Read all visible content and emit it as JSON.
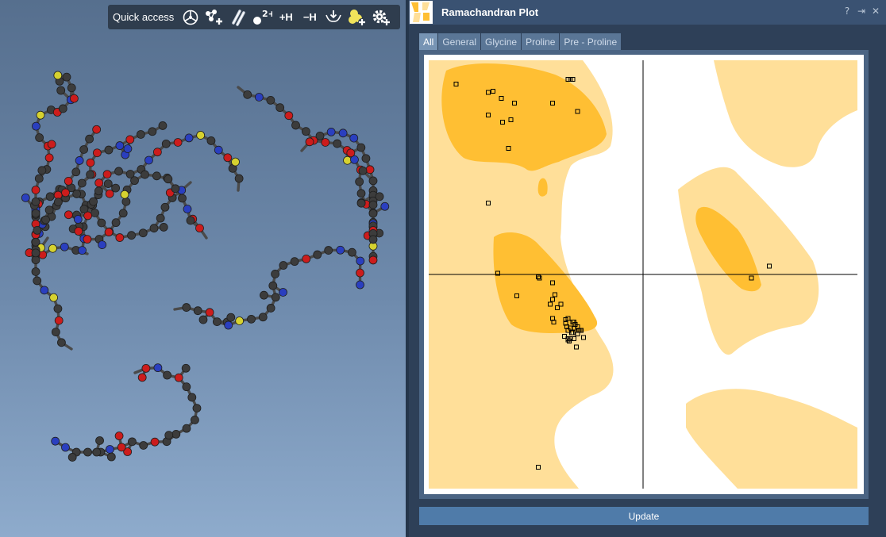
{
  "quick_access": {
    "label": "Quick access",
    "buttons": [
      {
        "name": "wheel-icon",
        "text": ""
      },
      {
        "name": "add-fragment-icon",
        "text": ""
      },
      {
        "name": "bond-tool-icon",
        "text": ""
      },
      {
        "name": "charge-icon",
        "text": ""
      },
      {
        "name": "add-hydrogen-button",
        "text": "+H"
      },
      {
        "name": "remove-hydrogen-button",
        "text": "−H"
      },
      {
        "name": "minimize-icon",
        "text": ""
      },
      {
        "name": "add-ligand-icon",
        "text": ""
      },
      {
        "name": "settings-icon",
        "text": ""
      }
    ]
  },
  "panel": {
    "title": "Ramachandran Plot",
    "controls": [
      "?",
      "⇥",
      "✕"
    ],
    "tabs": [
      "All",
      "General",
      "Glycine",
      "Proline",
      "Pre - Proline"
    ],
    "active_tab": 0,
    "update_label": "Update"
  },
  "colors": {
    "allowed_region": "#ffdf99",
    "favored_region": "#ffbf33",
    "viewport_top": "#566f8e",
    "viewport_bottom": "#8eabcc",
    "atom_carbon": "#3c3c3c",
    "atom_oxygen": "#cc1c1c",
    "atom_nitrogen": "#2a3fbf",
    "atom_sulfur": "#d6d230",
    "accent": "#4f7ba9"
  },
  "chart_data": {
    "type": "scatter",
    "title": "",
    "xlabel": "",
    "ylabel": "",
    "xlim": [
      -180,
      180
    ],
    "ylim": [
      -180,
      180
    ],
    "grid": false,
    "series": [
      {
        "points": [
          [
            -157,
            160
          ],
          [
            -130,
            153
          ],
          [
            -126,
            154
          ],
          [
            -119,
            148
          ],
          [
            -108,
            144
          ],
          [
            -76,
            144
          ],
          [
            -63,
            164
          ],
          [
            -61,
            164
          ],
          [
            -59,
            164
          ],
          [
            -55,
            137
          ],
          [
            -130,
            134
          ],
          [
            -111,
            130
          ],
          [
            -118,
            128
          ],
          [
            -113,
            106
          ],
          [
            -130,
            60
          ],
          [
            -122,
            1
          ],
          [
            -88,
            -2
          ],
          [
            -87,
            -3
          ],
          [
            -106,
            -18
          ],
          [
            -76,
            -7
          ],
          [
            -74,
            -17
          ],
          [
            -76,
            -21
          ],
          [
            -78,
            -25
          ],
          [
            -69,
            -25
          ],
          [
            -72,
            -28
          ],
          [
            -76,
            -37
          ],
          [
            -75,
            -40
          ],
          [
            -63,
            -37
          ],
          [
            -58,
            -40
          ],
          [
            -58,
            -45
          ],
          [
            -59,
            -40
          ],
          [
            -65,
            -38
          ],
          [
            -64,
            -44
          ],
          [
            -61,
            -45
          ],
          [
            -63,
            -47
          ],
          [
            -55,
            -44
          ],
          [
            -59,
            -49
          ],
          [
            -52,
            -47
          ],
          [
            -54,
            -47
          ],
          [
            -53,
            -47
          ],
          [
            -63,
            -54
          ],
          [
            -61,
            -54
          ],
          [
            -58,
            -54
          ],
          [
            -50,
            -53
          ],
          [
            -63,
            -55
          ],
          [
            -62,
            -56
          ],
          [
            -56,
            -61
          ],
          [
            -57,
            -42
          ],
          [
            -55,
            -50
          ],
          [
            -60,
            -49
          ],
          [
            -66,
            -52
          ],
          [
            -65,
            -41
          ],
          [
            -88,
            -162
          ],
          [
            91,
            -3
          ],
          [
            106,
            7
          ]
        ]
      }
    ]
  }
}
